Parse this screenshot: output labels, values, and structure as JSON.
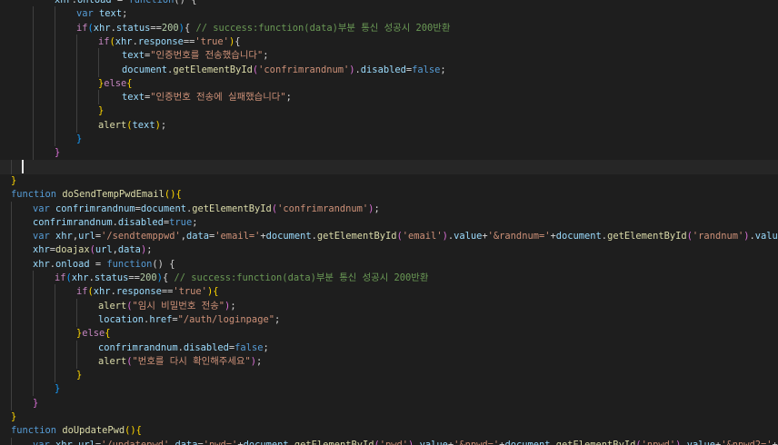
{
  "editor": {
    "colors": {
      "background": "#1e1e1e",
      "keyword": "#569cd6",
      "control": "#c586c0",
      "function": "#dcdcaa",
      "variable": "#9cdcfe",
      "string": "#ce9178",
      "number": "#b5cea8",
      "comment": "#6a9955",
      "punctuation": "#d4d4d4",
      "bracket1": "#ffd700",
      "bracket2": "#da70d6",
      "bracket3": "#179fff"
    },
    "lines": [
      {
        "tokens": [
          [
            "xhr",
            "v"
          ],
          [
            ".",
            "p"
          ],
          [
            "onload",
            "v"
          ],
          [
            " = ",
            "p"
          ],
          [
            "function",
            "k"
          ],
          [
            "() {",
            "p"
          ]
        ]
      },
      {
        "tokens": [
          [
            "var",
            "k"
          ],
          [
            " ",
            "p"
          ],
          [
            "text",
            "v"
          ],
          [
            ";",
            "p"
          ]
        ]
      },
      {
        "tokens": [
          [
            "if",
            "c"
          ],
          [
            "(",
            "b3"
          ],
          [
            "xhr",
            "v"
          ],
          [
            ".",
            "p"
          ],
          [
            "status",
            "v"
          ],
          [
            "==",
            "p"
          ],
          [
            "200",
            "n"
          ],
          [
            ")",
            "b3"
          ],
          [
            "{ ",
            "p"
          ],
          [
            "// success:function(data)부분 통신 성공시 200반환",
            "m"
          ]
        ]
      },
      {
        "tokens": [
          [
            "if",
            "c"
          ],
          [
            "(",
            "b1"
          ],
          [
            "xhr",
            "v"
          ],
          [
            ".",
            "p"
          ],
          [
            "response",
            "v"
          ],
          [
            "==",
            "p"
          ],
          [
            "'true'",
            "s"
          ],
          [
            ")",
            "b1"
          ],
          [
            "{",
            "p"
          ]
        ]
      },
      {
        "tokens": [
          [
            "text",
            "v"
          ],
          [
            "=",
            "p"
          ],
          [
            "\"인증번호를 전송했습니다\"",
            "s"
          ],
          [
            ";",
            "p"
          ]
        ]
      },
      {
        "tokens": [
          [
            "document",
            "v"
          ],
          [
            ".",
            "p"
          ],
          [
            "getElementById",
            "f"
          ],
          [
            "(",
            "b2"
          ],
          [
            "'confrimrandnum'",
            "s"
          ],
          [
            ")",
            "b2"
          ],
          [
            ".",
            "p"
          ],
          [
            "disabled",
            "v"
          ],
          [
            "=",
            "p"
          ],
          [
            "false",
            "k"
          ],
          [
            ";",
            "p"
          ]
        ]
      },
      {
        "tokens": [
          [
            "}",
            "b1"
          ],
          [
            "else",
            "c"
          ],
          [
            "{",
            "b1"
          ]
        ]
      },
      {
        "tokens": [
          [
            "text",
            "v"
          ],
          [
            "=",
            "p"
          ],
          [
            "\"인증번호 전송에 실패했습니다\"",
            "s"
          ],
          [
            ";",
            "p"
          ]
        ]
      },
      {
        "tokens": [
          [
            "}",
            "b1"
          ]
        ]
      },
      {
        "tokens": [
          [
            "alert",
            "f"
          ],
          [
            "(",
            "b1"
          ],
          [
            "text",
            "v"
          ],
          [
            ")",
            "b1"
          ],
          [
            ";",
            "p"
          ]
        ]
      },
      {
        "tokens": [
          [
            "}",
            "b3"
          ]
        ]
      },
      {
        "tokens": [
          [
            "}",
            "b2"
          ]
        ]
      },
      {
        "tokens": []
      },
      {
        "tokens": [
          [
            "}",
            "b1"
          ]
        ]
      },
      {
        "tokens": [
          [
            "function",
            "k"
          ],
          [
            " ",
            "p"
          ],
          [
            "doSendTempPwdEmail",
            "f"
          ],
          [
            "(",
            "b1"
          ],
          [
            ")",
            "b1"
          ],
          [
            "{",
            "b1"
          ]
        ]
      },
      {
        "tokens": [
          [
            "var",
            "k"
          ],
          [
            " ",
            "p"
          ],
          [
            "confrimrandnum",
            "v"
          ],
          [
            "=",
            "p"
          ],
          [
            "document",
            "v"
          ],
          [
            ".",
            "p"
          ],
          [
            "getElementById",
            "f"
          ],
          [
            "(",
            "b2"
          ],
          [
            "'confrimrandnum'",
            "s"
          ],
          [
            ")",
            "b2"
          ],
          [
            ";",
            "p"
          ]
        ]
      },
      {
        "tokens": [
          [
            "confrimrandnum",
            "v"
          ],
          [
            ".",
            "p"
          ],
          [
            "disabled",
            "v"
          ],
          [
            "=",
            "p"
          ],
          [
            "true",
            "k"
          ],
          [
            ";",
            "p"
          ]
        ]
      },
      {
        "tokens": [
          [
            "var",
            "k"
          ],
          [
            " ",
            "p"
          ],
          [
            "xhr",
            "v"
          ],
          [
            ",",
            "p"
          ],
          [
            "url",
            "v"
          ],
          [
            "=",
            "p"
          ],
          [
            "'/sendtemppwd'",
            "s"
          ],
          [
            ",",
            "p"
          ],
          [
            "data",
            "v"
          ],
          [
            "=",
            "p"
          ],
          [
            "'email='",
            "s"
          ],
          [
            "+",
            "p"
          ],
          [
            "document",
            "v"
          ],
          [
            ".",
            "p"
          ],
          [
            "getElementById",
            "f"
          ],
          [
            "(",
            "b2"
          ],
          [
            "'email'",
            "s"
          ],
          [
            ")",
            "b2"
          ],
          [
            ".",
            "p"
          ],
          [
            "value",
            "v"
          ],
          [
            "+",
            "p"
          ],
          [
            "'&randnum='",
            "s"
          ],
          [
            "+",
            "p"
          ],
          [
            "document",
            "v"
          ],
          [
            ".",
            "p"
          ],
          [
            "getElementById",
            "f"
          ],
          [
            "(",
            "b2"
          ],
          [
            "'randnum'",
            "s"
          ],
          [
            ")",
            "b2"
          ],
          [
            ".",
            "p"
          ],
          [
            "value",
            "v"
          ],
          [
            ";",
            "p"
          ]
        ]
      },
      {
        "tokens": [
          [
            "xhr",
            "v"
          ],
          [
            "=",
            "p"
          ],
          [
            "doajax",
            "f"
          ],
          [
            "(",
            "b2"
          ],
          [
            "url",
            "v"
          ],
          [
            ",",
            "p"
          ],
          [
            "data",
            "v"
          ],
          [
            ")",
            "b2"
          ],
          [
            ";",
            "p"
          ]
        ]
      },
      {
        "tokens": [
          [
            "xhr",
            "v"
          ],
          [
            ".",
            "p"
          ],
          [
            "onload",
            "v"
          ],
          [
            " = ",
            "p"
          ],
          [
            "function",
            "k"
          ],
          [
            "() {",
            "p"
          ]
        ]
      },
      {
        "tokens": [
          [
            "if",
            "c"
          ],
          [
            "(",
            "b3"
          ],
          [
            "xhr",
            "v"
          ],
          [
            ".",
            "p"
          ],
          [
            "status",
            "v"
          ],
          [
            "==",
            "p"
          ],
          [
            "200",
            "n"
          ],
          [
            ")",
            "b3"
          ],
          [
            "{ ",
            "p"
          ],
          [
            "// success:function(data)부분 통신 성공시 200반환",
            "m"
          ]
        ]
      },
      {
        "tokens": [
          [
            "if",
            "c"
          ],
          [
            "(",
            "b1"
          ],
          [
            "xhr",
            "v"
          ],
          [
            ".",
            "p"
          ],
          [
            "response",
            "v"
          ],
          [
            "==",
            "p"
          ],
          [
            "'true'",
            "s"
          ],
          [
            ")",
            "b1"
          ],
          [
            "{",
            "b1"
          ]
        ]
      },
      {
        "tokens": [
          [
            "alert",
            "f"
          ],
          [
            "(",
            "b2"
          ],
          [
            "\"임시 비밀번호 전송\"",
            "s"
          ],
          [
            ")",
            "b2"
          ],
          [
            ";",
            "p"
          ]
        ]
      },
      {
        "tokens": [
          [
            "location",
            "v"
          ],
          [
            ".",
            "p"
          ],
          [
            "href",
            "v"
          ],
          [
            "=",
            "p"
          ],
          [
            "\"/auth/loginpage\"",
            "s"
          ],
          [
            ";",
            "p"
          ]
        ]
      },
      {
        "tokens": [
          [
            "}",
            "b1"
          ],
          [
            "else",
            "c"
          ],
          [
            "{",
            "b1"
          ]
        ]
      },
      {
        "tokens": [
          [
            "confrimrandnum",
            "v"
          ],
          [
            ".",
            "p"
          ],
          [
            "disabled",
            "v"
          ],
          [
            "=",
            "p"
          ],
          [
            "false",
            "k"
          ],
          [
            ";",
            "p"
          ]
        ]
      },
      {
        "tokens": [
          [
            "alert",
            "f"
          ],
          [
            "(",
            "b2"
          ],
          [
            "\"번호를 다시 확인해주세요\"",
            "s"
          ],
          [
            ")",
            "b2"
          ],
          [
            ";",
            "p"
          ]
        ]
      },
      {
        "tokens": [
          [
            "}",
            "b1"
          ]
        ]
      },
      {
        "tokens": [
          [
            "}",
            "b3"
          ]
        ]
      },
      {
        "tokens": [
          [
            "}",
            "b2"
          ]
        ]
      },
      {
        "tokens": [
          [
            "}",
            "b1"
          ]
        ]
      },
      {
        "tokens": [
          [
            "function",
            "k"
          ],
          [
            " ",
            "p"
          ],
          [
            "doUpdatePwd",
            "f"
          ],
          [
            "(",
            "b1"
          ],
          [
            ")",
            "b1"
          ],
          [
            "{",
            "b1"
          ]
        ]
      },
      {
        "tokens": [
          [
            "var",
            "k"
          ],
          [
            " ",
            "p"
          ],
          [
            "xhr",
            "v"
          ],
          [
            ",",
            "p"
          ],
          [
            "url",
            "v"
          ],
          [
            "=",
            "p"
          ],
          [
            "'/updatepwd'",
            "s"
          ],
          [
            ",",
            "p"
          ],
          [
            "data",
            "v"
          ],
          [
            "=",
            "p"
          ],
          [
            "'pwd='",
            "s"
          ],
          [
            "+",
            "p"
          ],
          [
            "document",
            "v"
          ],
          [
            ".",
            "p"
          ],
          [
            "getElementById",
            "f"
          ],
          [
            "(",
            "b2"
          ],
          [
            "'pwd'",
            "s"
          ],
          [
            ")",
            "b2"
          ],
          [
            ".",
            "p"
          ],
          [
            "value",
            "v"
          ],
          [
            "+",
            "p"
          ],
          [
            "'&npwd='",
            "s"
          ],
          [
            "+",
            "p"
          ],
          [
            "document",
            "v"
          ],
          [
            ".",
            "p"
          ],
          [
            "getElementById",
            "f"
          ],
          [
            "(",
            "b2"
          ],
          [
            "'npwd'",
            "s"
          ],
          [
            ")",
            "b2"
          ],
          [
            ".",
            "p"
          ],
          [
            "value",
            "v"
          ],
          [
            "+",
            "p"
          ],
          [
            "'&npwd2='",
            "s"
          ],
          [
            "+",
            "p"
          ],
          [
            "docu",
            "v"
          ]
        ]
      }
    ]
  }
}
